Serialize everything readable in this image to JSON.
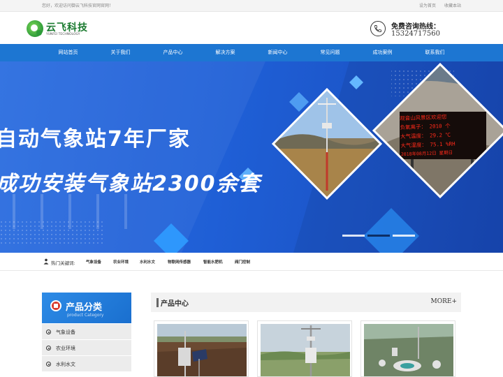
{
  "topbar": {
    "welcome": "您好，欢迎访问御云飞科技官网官网！",
    "set_home": "设为首页",
    "bookmark": "收藏本站"
  },
  "header": {
    "logo_cn": "云飞科技",
    "logo_en": "YUNFEI TECHNOLOGY",
    "hotline_label": "免费咨询热线：",
    "hotline_number": "15324717560"
  },
  "nav": {
    "items": [
      "网站首页",
      "关于我们",
      "产品中心",
      "解决方案",
      "新闻中心",
      "常见问题",
      "成功案例",
      "联系我们"
    ]
  },
  "banner": {
    "line1": "自动气象站7年厂家",
    "line2": "成功安装气象站2300余套",
    "sign_text": [
      "观音山风景区欢迎您",
      "负氧离子：  2010   个",
      "大气温度：  29.2  ℃",
      "大气湿度：  75.1  %RH",
      "2018年08月12日  星期日"
    ]
  },
  "hot": {
    "label": "热门关键词:",
    "keywords": [
      "气象设备",
      "农业环境",
      "水利水文",
      "物联网传感器",
      "智能水肥机",
      "阀门控制"
    ]
  },
  "sidebar": {
    "title": "产品分类",
    "subtitle": "product Category",
    "items": [
      "气象设备",
      "农业环境",
      "水利水文"
    ]
  },
  "products": {
    "title": "产品中心",
    "more": "MORE+"
  },
  "colors": {
    "nav_blue": "#1d76d2",
    "banner_blue": "#1f5fd6",
    "sign_red": "#ff2a1a"
  }
}
